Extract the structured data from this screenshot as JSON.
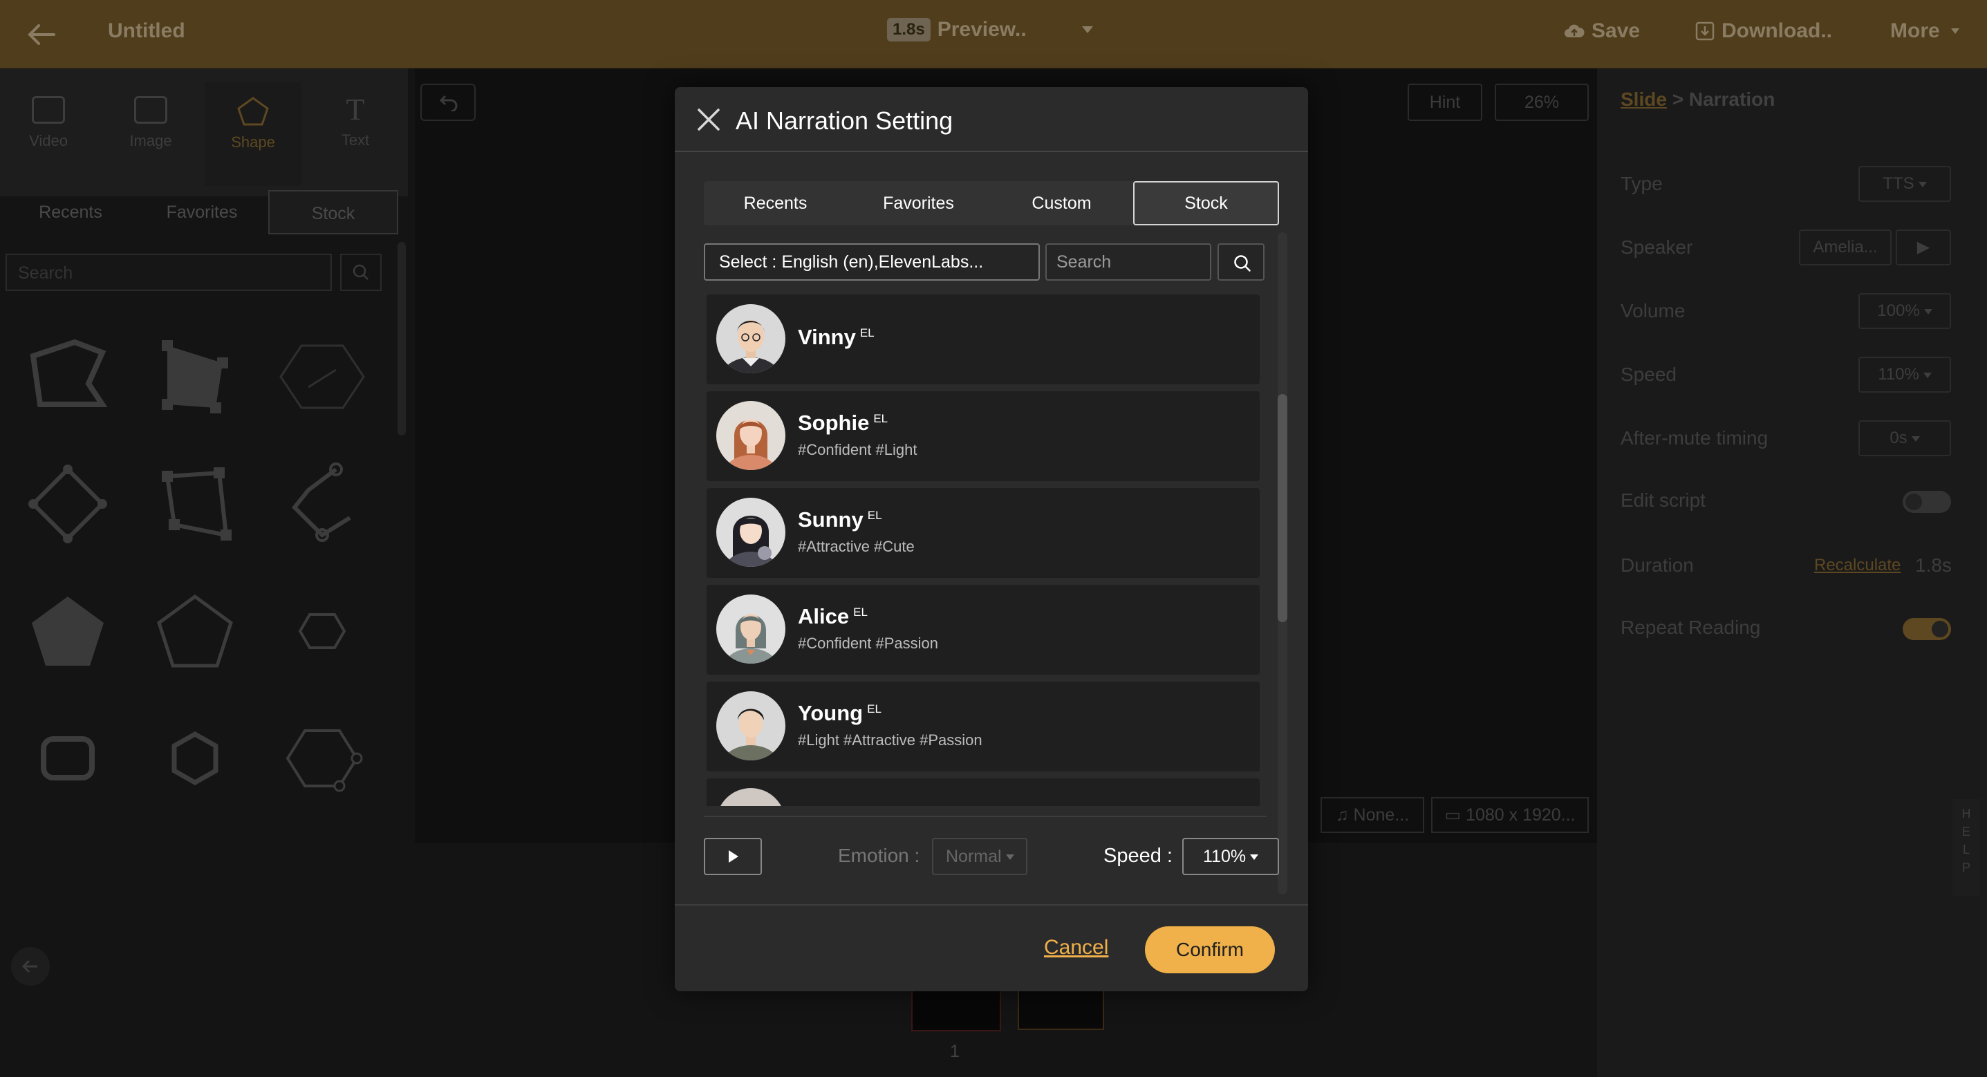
{
  "colors": {
    "accent": "#f0b04a",
    "topbar": "#503d1c",
    "modal_bg": "#2b2b2b",
    "row_bg": "#1f1f1f"
  },
  "topbar": {
    "title": "Untitled",
    "preview_badge": "1.8s",
    "preview_label": "Preview..",
    "save_label": "Save",
    "download_label": "Download..",
    "more_label": "More"
  },
  "left": {
    "tools": [
      {
        "label": "Video",
        "icon": "video-icon"
      },
      {
        "label": "Image",
        "icon": "image-icon"
      },
      {
        "label": "Shape",
        "icon": "pentagon-icon"
      },
      {
        "label": "Text",
        "icon": "text-icon"
      }
    ],
    "tabs": [
      "Recents",
      "Favorites",
      "Stock"
    ],
    "search_placeholder": "Search"
  },
  "canvas": {
    "hint_label": "Hint",
    "zoom_label": "26%",
    "audio_label": "None...",
    "resolution_label": "1080 x 1920...",
    "page_number": "1"
  },
  "right": {
    "crumb_link": "Slide",
    "crumb_current": "Narration",
    "type_label": "Type",
    "type_value": "TTS",
    "speaker_label": "Speaker",
    "speaker_value": "Amelia...",
    "volume_label": "Volume",
    "volume_value": "100%",
    "speed_label": "Speed",
    "speed_value": "110%",
    "aftermute_label": "After-mute timing",
    "aftermute_value": "0s",
    "editscript_label": "Edit script",
    "duration_label": "Duration",
    "recalculate_label": "Recalculate",
    "duration_value": "1.8s",
    "repeat_label": "Repeat Reading",
    "help_letters": [
      "H",
      "E",
      "L",
      "P"
    ]
  },
  "modal": {
    "title": "AI Narration Setting",
    "tabs": [
      "Recents",
      "Favorites",
      "Custom",
      "Stock"
    ],
    "active_tab": "Stock",
    "filter_select": "Select : English (en),ElevenLabs...",
    "search_placeholder": "Search",
    "voices": [
      {
        "name": "Vinny",
        "badge": "EL",
        "tags": ""
      },
      {
        "name": "Sophie",
        "badge": "EL",
        "tags": "#Confident  #Light"
      },
      {
        "name": "Sunny",
        "badge": "EL",
        "tags": "#Attractive  #Cute"
      },
      {
        "name": "Alice",
        "badge": "EL",
        "tags": "#Confident  #Passion"
      },
      {
        "name": "Young",
        "badge": "EL",
        "tags": "#Light  #Attractive  #Passion"
      }
    ],
    "emotion_label": "Emotion :",
    "emotion_value": "Normal",
    "speed_label": "Speed :",
    "speed_value": "110%",
    "cancel_label": "Cancel",
    "confirm_label": "Confirm"
  }
}
